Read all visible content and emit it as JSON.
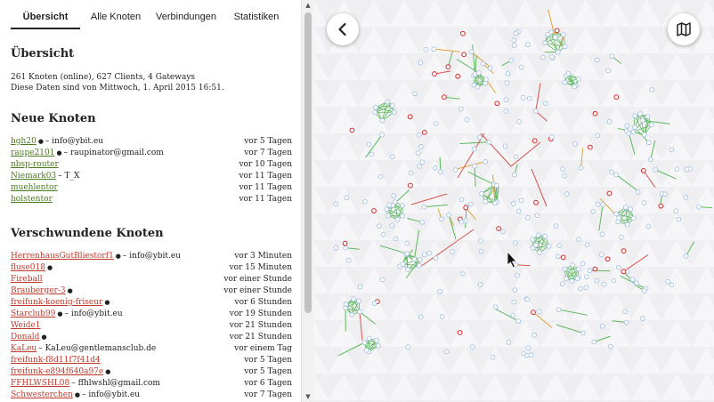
{
  "tabs": [
    "Übersicht",
    "Alle Knoten",
    "Verbindungen",
    "Statistiken"
  ],
  "overview": {
    "title": "Übersicht",
    "summary": "261 Knoten (online), 627 Clients, 4 Gateways",
    "date": "Diese Daten sind von Mittwoch, 1. April 2015 16:51."
  },
  "new_nodes": {
    "title": "Neue Knoten",
    "items": [
      {
        "name": "hgh20",
        "pin": true,
        "extra": "– info@ybit.eu",
        "time": "vor 5 Tagen"
      },
      {
        "name": "raupe2101",
        "pin": true,
        "extra": "– raupinator@gmail.com",
        "time": "vor 7 Tagen"
      },
      {
        "name": "nbsp-router",
        "pin": false,
        "extra": "",
        "time": "vor 10 Tagen"
      },
      {
        "name": "Niemark03",
        "pin": false,
        "extra": "– T_X",
        "time": "vor 11 Tagen"
      },
      {
        "name": "muehlentor",
        "pin": false,
        "extra": "",
        "time": "vor 11 Tagen"
      },
      {
        "name": "holstentor",
        "pin": false,
        "extra": "",
        "time": "vor 11 Tagen"
      }
    ]
  },
  "gone_nodes": {
    "title": "Verschwundene Knoten",
    "items": [
      {
        "name": "HerrenhausGutBliestorf1",
        "pin": true,
        "extra": "– info@ybit.eu",
        "time": "vor 3 Minuten"
      },
      {
        "name": "fluse018",
        "pin": true,
        "extra": "",
        "time": "vor 15 Minuten"
      },
      {
        "name": "Fireball",
        "pin": false,
        "extra": "",
        "time": "vor einer Stunde"
      },
      {
        "name": "Brauberger-3",
        "pin": true,
        "extra": "",
        "time": "vor einer Stunde"
      },
      {
        "name": "freifunk-koenig-friseur",
        "pin": true,
        "extra": "",
        "time": "vor 6 Stunden"
      },
      {
        "name": "Starclub99",
        "pin": true,
        "extra": "– info@ybit.eu",
        "time": "vor 19 Stunden"
      },
      {
        "name": "Weide1",
        "pin": false,
        "extra": "",
        "time": "vor 21 Stunden"
      },
      {
        "name": "Donald",
        "pin": true,
        "extra": "",
        "time": "vor 21 Stunden"
      },
      {
        "name": "KaLeu",
        "pin": false,
        "extra": "– KaLeu@gentlemansclub.de",
        "time": "vor einem Tag"
      },
      {
        "name": "freifunk-f8d11f7f41d4",
        "pin": false,
        "extra": "",
        "time": "vor 5 Tagen"
      },
      {
        "name": "freifunk-e894f640a97e",
        "pin": true,
        "extra": "",
        "time": "vor 5 Tagen"
      },
      {
        "name": "FFHLWSHL08",
        "pin": false,
        "extra": "– ffhlwshl@gmail.com",
        "time": "vor 6 Tagen"
      },
      {
        "name": "Schwesterchen",
        "pin": true,
        "extra": "– info@ybit.eu",
        "time": "vor 7 Tagen"
      }
    ]
  },
  "icons": {
    "pin": "map-pin-icon",
    "back": "chevron-left-icon",
    "map": "map-icon",
    "scroll_up": "triangle-up-icon",
    "scroll_down": "triangle-down-icon"
  },
  "colors": {
    "link_new": "#4c7a1f",
    "link_gone": "#c0392b",
    "node_online": "#aec7e8",
    "node_offline": "#d62728",
    "link_good": "#5cb85c",
    "link_bad": "#d9534f"
  }
}
